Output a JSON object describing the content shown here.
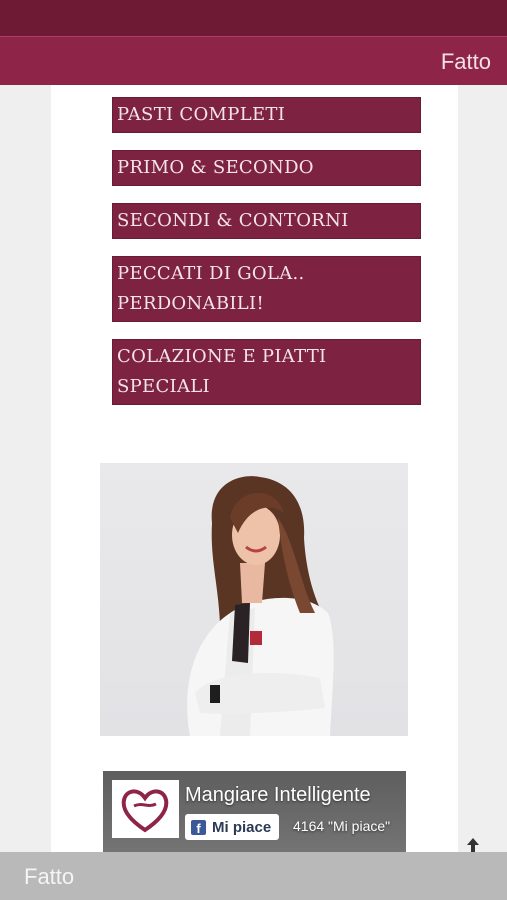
{
  "header": {
    "done_label": "Fatto"
  },
  "menu": {
    "items": [
      {
        "label": "Pasti completi"
      },
      {
        "label": "Primo & Secondo"
      },
      {
        "label": "Secondi & Contorni"
      },
      {
        "label": "Peccati di gola.. perdonabili!"
      },
      {
        "label": "Colazione e piatti speciali"
      }
    ]
  },
  "facebook_widget": {
    "page_name": "Mangiare Intelligente",
    "like_label": "Mi piace",
    "like_count": "4164 \"Mi piace\""
  },
  "footer": {
    "done_label": "Fatto"
  },
  "colors": {
    "brand": "#8e2548",
    "button": "#7d2341",
    "status_bar": "#6e1a35"
  }
}
